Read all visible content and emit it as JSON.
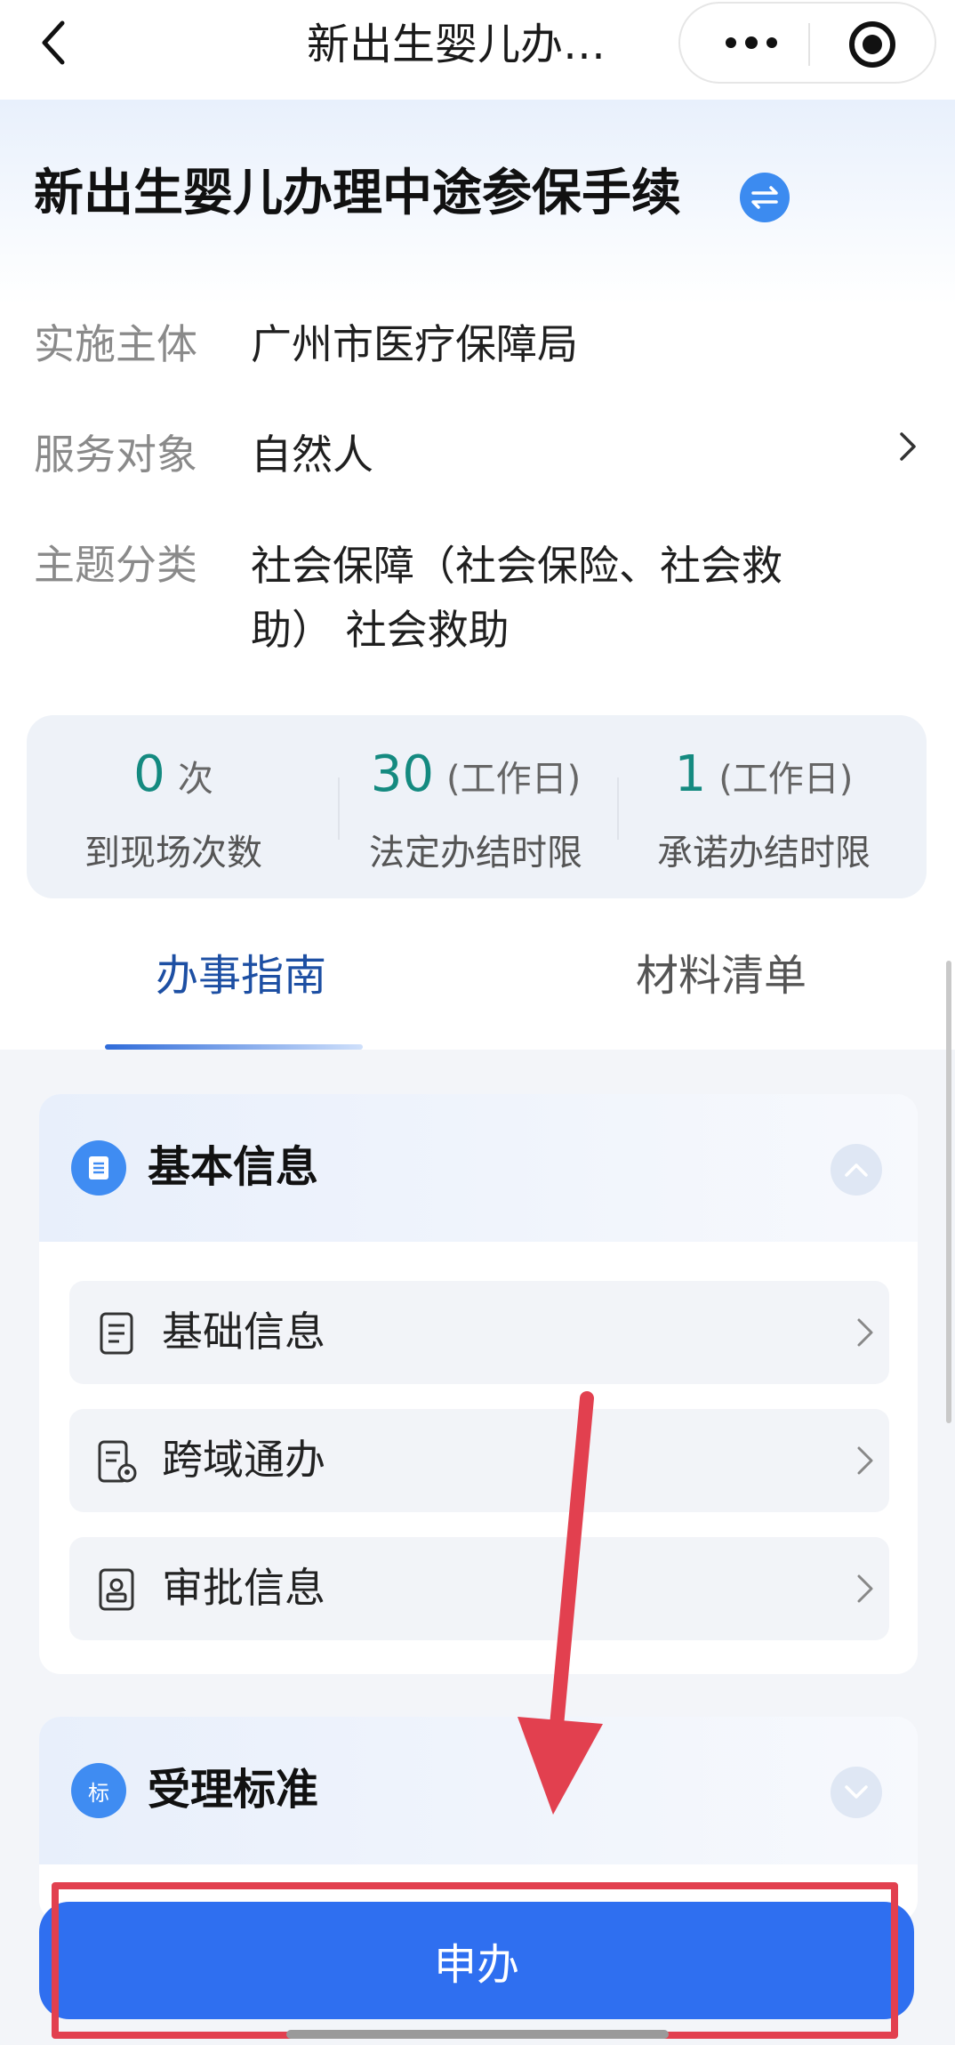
{
  "nav": {
    "back_icon": "chevron-left-icon",
    "title": "新出生婴儿办…",
    "more_icon": "more-dots-icon",
    "close_icon": "target-close-icon"
  },
  "header": {
    "title": "新出生婴儿办理中途参保手续",
    "switch_icon": "switch-arrows-icon",
    "rows": [
      {
        "label": "实施主体",
        "value": "广州市医疗保障局"
      },
      {
        "label": "服务对象",
        "value": "自然人"
      },
      {
        "label": "主题分类",
        "value": "社会保障（社会保险、社会救助） 社会救助"
      }
    ]
  },
  "stats": [
    {
      "number": "0",
      "unit": "次",
      "label": "到现场次数"
    },
    {
      "number": "30",
      "unit": "(工作日)",
      "label": "法定办结时限"
    },
    {
      "number": "1",
      "unit": "(工作日)",
      "label": "承诺办结时限"
    }
  ],
  "tabs": [
    {
      "label": "办事指南",
      "active": true
    },
    {
      "label": "材料清单",
      "active": false
    }
  ],
  "sections": [
    {
      "title": "基本信息",
      "expanded": true,
      "items": [
        {
          "label": "基础信息",
          "icon": "document-icon"
        },
        {
          "label": "跨域通办",
          "icon": "document-location-icon"
        },
        {
          "label": "审批信息",
          "icon": "stamp-document-icon"
        }
      ]
    },
    {
      "title": "受理标准",
      "badge": "标",
      "expanded": false
    }
  ],
  "apply_button": "申办",
  "colors": {
    "accent": "#2f6ff0",
    "stat_number": "#148a80",
    "active_tab": "#1d4fa3",
    "highlight": "#e2404f"
  }
}
